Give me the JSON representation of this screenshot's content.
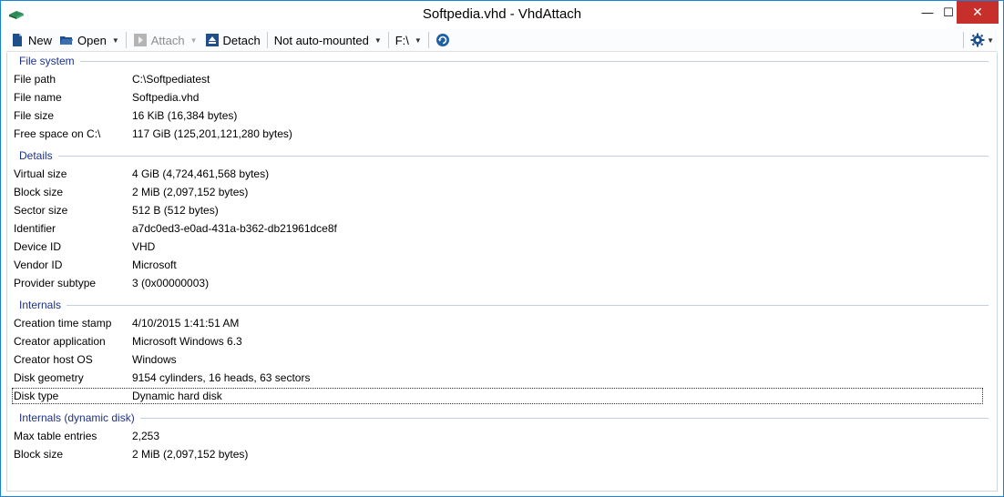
{
  "window": {
    "title": "Softpedia.vhd - VhdAttach"
  },
  "titlebar": {
    "minimize_glyph": "—",
    "maximize_glyph": "☐",
    "close_glyph": "✕"
  },
  "toolbar": {
    "new_label": "New",
    "open_label": "Open",
    "attach_label": "Attach",
    "detach_label": "Detach",
    "automount_label": "Not auto-mounted",
    "drive_label": "F:\\",
    "dropdown_glyph": "▼",
    "settings_icon": "gear-icon",
    "refresh_icon": "refresh-icon"
  },
  "groups": {
    "file_system": {
      "title": "File system",
      "rows": [
        {
          "label": "File path",
          "value": "C:\\Softpediatest"
        },
        {
          "label": "File name",
          "value": "Softpedia.vhd"
        },
        {
          "label": "File size",
          "value": "16 KiB (16,384 bytes)"
        },
        {
          "label": "Free space on C:\\",
          "value": "117 GiB (125,201,121,280 bytes)"
        }
      ]
    },
    "details": {
      "title": "Details",
      "rows": [
        {
          "label": "Virtual size",
          "value": "4 GiB (4,724,461,568 bytes)"
        },
        {
          "label": "Block size",
          "value": "2 MiB (2,097,152 bytes)"
        },
        {
          "label": "Sector size",
          "value": "512 B (512 bytes)"
        },
        {
          "label": "Identifier",
          "value": "a7dc0ed3-e0ad-431a-b362-db21961dce8f"
        },
        {
          "label": "Device ID",
          "value": "VHD"
        },
        {
          "label": "Vendor ID",
          "value": "Microsoft"
        },
        {
          "label": "Provider subtype",
          "value": "3 (0x00000003)"
        }
      ]
    },
    "internals": {
      "title": "Internals",
      "rows": [
        {
          "label": "Creation time stamp",
          "value": "4/10/2015 1:41:51 AM"
        },
        {
          "label": "Creator application",
          "value": "Microsoft Windows 6.3"
        },
        {
          "label": "Creator host OS",
          "value": "Windows"
        },
        {
          "label": "Disk geometry",
          "value": "9154 cylinders, 16 heads, 63 sectors"
        },
        {
          "label": "Disk type",
          "value": "Dynamic hard disk"
        }
      ]
    },
    "internals_dynamic": {
      "title": "Internals (dynamic disk)",
      "rows": [
        {
          "label": "Max table entries",
          "value": "2,253"
        },
        {
          "label": "Block size",
          "value": "2 MiB (2,097,152 bytes)"
        }
      ]
    }
  },
  "colors": {
    "group_header": "#1e3287",
    "close_button": "#c7302a",
    "window_border": "#1883d7",
    "accent_icon": "#1f5fa8"
  }
}
